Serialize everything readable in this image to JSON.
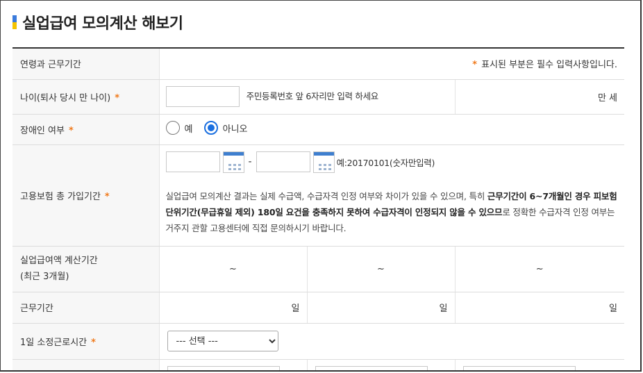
{
  "title": "실업급여 모의계산 해보기",
  "header_row": {
    "label": "연령과 근무기간",
    "req_mark": "*",
    "note": "표시된 부분은 필수 입력사항입니다."
  },
  "age_row": {
    "label": "나이(퇴사 당시 만 나이)",
    "req_mark": "*",
    "input_value": "",
    "hint": "주민등록번호 앞 6자리만 입력 하세요",
    "unit": "만 세"
  },
  "disability_row": {
    "label": "장애인 여부",
    "req_mark": "*",
    "options": [
      {
        "label": "예",
        "selected": false
      },
      {
        "label": "아니오",
        "selected": true
      }
    ]
  },
  "insurance_row": {
    "label": "고용보험 총 가입기간",
    "req_mark": "*",
    "start_value": "",
    "separator": "-",
    "end_value": "",
    "hint": "예:20170101(숫자만입력)",
    "note_part1": "실업급여 모의계산 결과는 실제 수급액, 수급자격 인정 여부와 차이가 있을 수 있으며, 특히 ",
    "note_bold1": "근무기간이 6~7개월인 경우 피보험단위기간(무급휴일 제외) 180일 요건을 충족하지 못하여 수급자격이 인정되지 않을 수 있으므",
    "note_part2": "로 정확한 수급자격 인정 여부는 거주지 관할 고용센터에 직접 문의하시기 바랍니다."
  },
  "calc_period_row": {
    "label_line1": "실업급여액 계산기간",
    "label_line2": "(최근 3개월)",
    "periods": [
      "~",
      "~",
      "~"
    ]
  },
  "work_days_row": {
    "label": "근무기간",
    "units": [
      "일",
      "일",
      "일"
    ]
  },
  "hours_row": {
    "label": "1일 소정근로시간",
    "req_mark": "*",
    "select_value": "--- 선택 ---"
  },
  "colors": {
    "accent_blue": "#1a6fe0",
    "required_orange": "#f07a1c",
    "title_mark_blue": "#3b7bdc",
    "title_mark_yellow": "#f5c400"
  }
}
